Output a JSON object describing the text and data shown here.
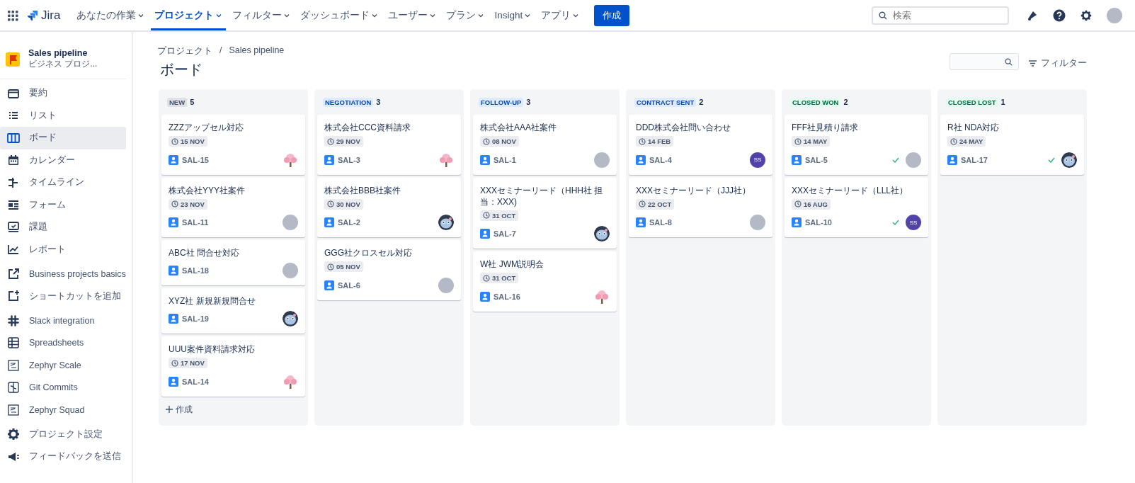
{
  "topbar": {
    "logo": "Jira",
    "nav": [
      {
        "label": "あなたの作業",
        "selected": false
      },
      {
        "label": "プロジェクト",
        "selected": true
      },
      {
        "label": "フィルター",
        "selected": false
      },
      {
        "label": "ダッシュボード",
        "selected": false
      },
      {
        "label": "ユーザー",
        "selected": false
      },
      {
        "label": "プラン",
        "selected": false
      },
      {
        "label": "Insight",
        "selected": false
      },
      {
        "label": "アプリ",
        "selected": false
      }
    ],
    "create": "作成",
    "search": {
      "placeholder": "検索"
    }
  },
  "sidebar": {
    "project": {
      "name": "Sales pipeline",
      "type": "ビジネス プロジ..."
    },
    "sections": [
      [
        {
          "label": "要約",
          "kind": "summary",
          "selected": false
        },
        {
          "label": "リスト",
          "kind": "list",
          "selected": false
        },
        {
          "label": "ボード",
          "kind": "board",
          "selected": true
        },
        {
          "label": "カレンダー",
          "kind": "calendar",
          "selected": false
        },
        {
          "label": "タイムライン",
          "kind": "timeline",
          "selected": false
        },
        {
          "label": "フォーム",
          "kind": "form",
          "selected": false
        },
        {
          "label": "課題",
          "kind": "issues",
          "selected": false
        },
        {
          "label": "レポート",
          "kind": "report",
          "selected": false
        }
      ],
      [
        {
          "label": "Business projects basics",
          "kind": "external",
          "selected": false
        },
        {
          "label": "ショートカットを追加",
          "kind": "shortcut",
          "selected": false
        }
      ],
      [
        {
          "label": "Slack integration",
          "kind": "slack",
          "selected": false
        },
        {
          "label": "Spreadsheets",
          "kind": "table",
          "selected": false
        },
        {
          "label": "Zephyr Scale",
          "kind": "app",
          "selected": false
        },
        {
          "label": "Git Commits",
          "kind": "git",
          "selected": false
        },
        {
          "label": "Zephyr Squad",
          "kind": "app",
          "selected": false
        }
      ],
      [
        {
          "label": "プロジェクト設定",
          "kind": "gear",
          "selected": false
        },
        {
          "label": "フィードバックを送信",
          "kind": "megaphone",
          "selected": false
        }
      ]
    ]
  },
  "breadcrumbs": {
    "items": [
      "プロジェクト",
      "Sales pipeline"
    ],
    "separator": "/"
  },
  "title": "ボード",
  "filter_button": "フィルター",
  "columns": [
    {
      "name": "NEW",
      "kind": "default",
      "count": "5",
      "create": "作成",
      "cards": [
        {
          "title": "ZZZアップセル対応",
          "due": "15 NOV",
          "key": "SAL-15",
          "avatar": {
            "kind": "tree"
          },
          "done": false
        },
        {
          "title": "株式会社YYY社案件",
          "due": "23 NOV",
          "key": "SAL-11",
          "avatar": {
            "kind": "photo"
          },
          "done": false
        },
        {
          "title": "ABC社 問合せ対応",
          "key": "SAL-18",
          "avatar": {
            "kind": "photo"
          },
          "done": false
        },
        {
          "title": "XYZ社 新規新規問合せ",
          "key": "SAL-19",
          "avatar": {
            "kind": "robot"
          },
          "done": false
        },
        {
          "title": "UUU案件資料請求対応",
          "due": "17 NOV",
          "key": "SAL-14",
          "avatar": {
            "kind": "tree"
          },
          "done": false
        }
      ]
    },
    {
      "name": "NEGOTIATION",
      "kind": "inprogress",
      "count": "3",
      "cards": [
        {
          "title": "株式会社CCC資料請求",
          "due": "29 NOV",
          "key": "SAL-3",
          "avatar": {
            "kind": "tree"
          },
          "done": false
        },
        {
          "title": "株式会社BBB社案件",
          "due": "30 NOV",
          "key": "SAL-2",
          "avatar": {
            "kind": "robot"
          },
          "done": false
        },
        {
          "title": "GGG社クロスセル対応",
          "due": "05 NOV",
          "key": "SAL-6",
          "avatar": {
            "kind": "photo"
          },
          "done": false
        }
      ]
    },
    {
      "name": "FOLLOW-UP",
      "kind": "inprogress",
      "count": "3",
      "cards": [
        {
          "title": "株式会社AAA社案件",
          "due": "08 NOV",
          "key": "SAL-1",
          "avatar": {
            "kind": "photo"
          },
          "done": false
        },
        {
          "title": "XXXセミナーリード（HHH社 担当：XXX)",
          "due": "31 OCT",
          "key": "SAL-7",
          "avatar": {
            "kind": "robot"
          },
          "done": false
        },
        {
          "title": "W社 JWM説明会",
          "due": "31 OCT",
          "key": "SAL-16",
          "avatar": {
            "kind": "tree"
          },
          "done": false
        }
      ]
    },
    {
      "name": "CONTRACT SENT",
      "kind": "inprogress",
      "count": "2",
      "cards": [
        {
          "title": "DDD株式会社問い合わせ",
          "due": "14 FEB",
          "key": "SAL-4",
          "avatar": {
            "kind": "initials",
            "initials": "SS"
          },
          "done": false
        },
        {
          "title": "XXXセミナーリード（JJJ社）",
          "due": "22 OCT",
          "key": "SAL-8",
          "avatar": {
            "kind": "photo"
          },
          "done": false
        }
      ]
    },
    {
      "name": "CLOSED WON",
      "kind": "success",
      "count": "2",
      "cards": [
        {
          "title": "FFF社見積り請求",
          "due": "14 MAY",
          "key": "SAL-5",
          "avatar": {
            "kind": "photo"
          },
          "done": true
        },
        {
          "title": "XXXセミナーリード（LLL社）",
          "due": "16 AUG",
          "key": "SAL-10",
          "avatar": {
            "kind": "initials",
            "initials": "SS"
          },
          "done": true
        }
      ]
    },
    {
      "name": "CLOSED LOST",
      "kind": "success",
      "count": "1",
      "cards": [
        {
          "title": "R社 NDA対応",
          "due": "24 MAY",
          "key": "SAL-17",
          "avatar": {
            "kind": "robot"
          },
          "done": true
        }
      ]
    }
  ]
}
